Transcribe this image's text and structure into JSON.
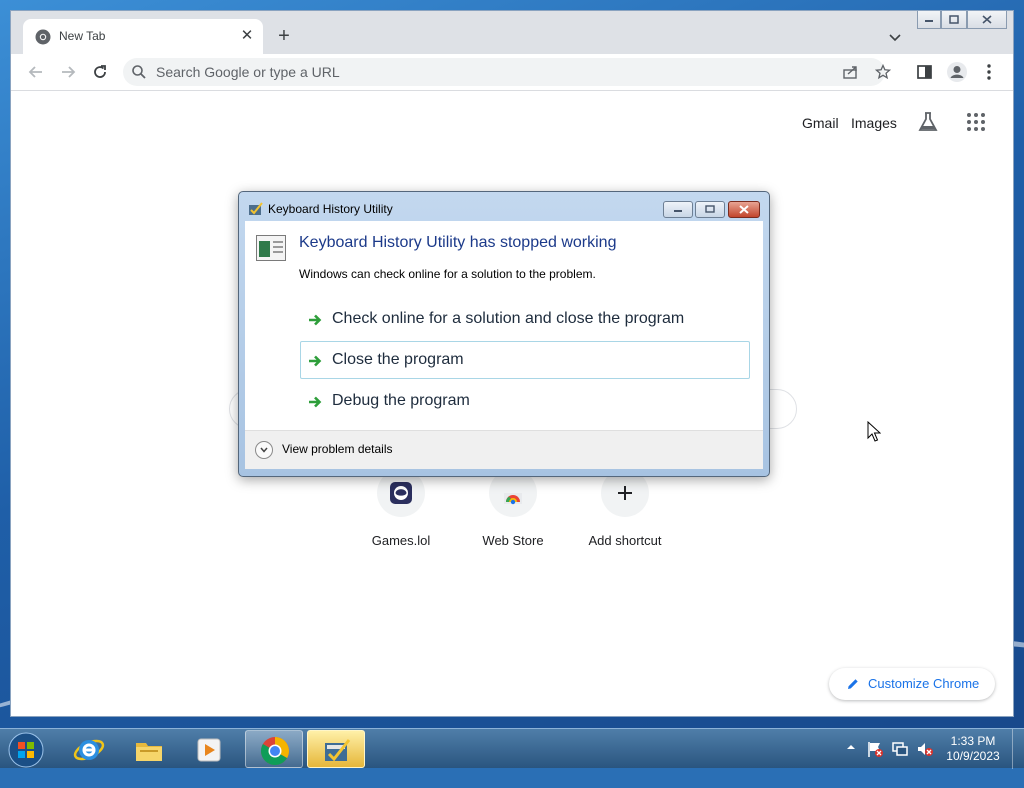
{
  "browser": {
    "tab": {
      "title": "New Tab"
    },
    "omnibox": {
      "placeholder": "Search Google or type a URL"
    },
    "ntp": {
      "links": {
        "gmail": "Gmail",
        "images": "Images"
      },
      "shortcuts": [
        {
          "label": "Games.lol",
          "icon": "games-lol-icon"
        },
        {
          "label": "Web Store",
          "icon": "web-store-icon"
        },
        {
          "label": "Add shortcut",
          "icon": "plus-icon"
        }
      ],
      "customize_label": "Customize Chrome"
    }
  },
  "dialog": {
    "title": "Keyboard History Utility",
    "heading": "Keyboard History Utility has stopped working",
    "subtext": "Windows can check online for a solution to the problem.",
    "options": [
      {
        "label": "Check online for a solution and close the program"
      },
      {
        "label": "Close the program"
      },
      {
        "label": "Debug the program"
      }
    ],
    "details_label": "View problem details"
  },
  "taskbar": {
    "clock": {
      "time": "1:33 PM",
      "date": "10/9/2023"
    }
  },
  "colors": {
    "dialog_heading": "#1c3a8a",
    "link_blue": "#1a73e8",
    "option_arrow": "#2e9e3a"
  }
}
